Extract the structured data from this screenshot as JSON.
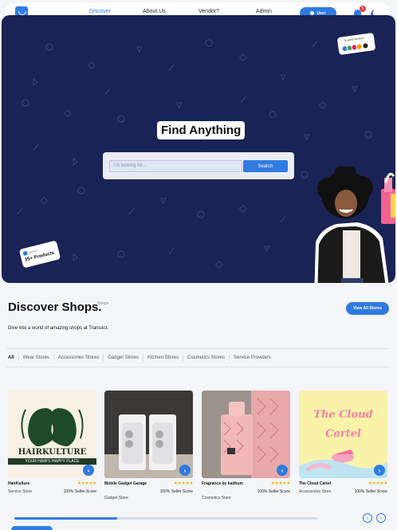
{
  "nav": {
    "links": [
      "Discover",
      "About Us",
      "Vendor?",
      "Admin"
    ],
    "user_label": "User",
    "notification_count": "5"
  },
  "hero": {
    "title": "Find Anything",
    "search_placeholder": "I'm looking for...",
    "search_button": "Search",
    "trust_label": "Trusted Vendors",
    "products_small": "Verified",
    "products_count": "35+ Products"
  },
  "discover": {
    "title": "Discover Shops.",
    "tag": "Shops",
    "view_all": "View All Stores",
    "subtitle": "Dive into a world of amazing shops at Transact.",
    "tabs": [
      "All",
      "Wear Stores",
      "Accessories Stores",
      "Gadget Stores",
      "Kitchen Stores",
      "Cosmetics Stores",
      "Service Providers"
    ]
  },
  "shops": [
    {
      "name": "HairKulture",
      "stars": "★★★★★",
      "score": "100% Seller Score",
      "type": "Service Store",
      "logo_line1": "HAIRKULTURE",
      "logo_line2": "YOUR HAIR'S HAPPY PLACE"
    },
    {
      "name": "Mobile Gadget Garage",
      "stars": "★★★★★",
      "score": "100% Seller Score",
      "type": "Gadget Store"
    },
    {
      "name": "Fragrance by kaithum",
      "stars": "★★★★★",
      "score": "100% Seller Score",
      "type": "Cosmetics Store"
    },
    {
      "name": "The Cloud Cartel",
      "stars": "★★★★★",
      "score": "100% Seller Score",
      "type": "Accessories Store",
      "logo_line1": "The Cloud",
      "logo_line2": "Cartel"
    }
  ],
  "carousel": {
    "progress": 0.34,
    "prev": "‹",
    "next": "›"
  },
  "colors": {
    "accent": "#2f7be0",
    "hero_bg": "#1a2355",
    "star": "#f4b400"
  }
}
